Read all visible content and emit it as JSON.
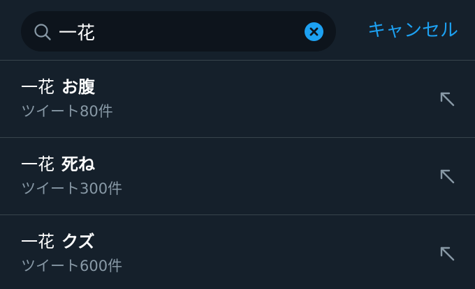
{
  "search": {
    "query": "一花",
    "placeholder": "",
    "clear_icon": "clear-circle-icon",
    "search_icon": "search-icon"
  },
  "header": {
    "cancel_label": "キャンセル"
  },
  "suggestions": [
    {
      "prefix": "一花",
      "suffix": "お腹",
      "count": "ツイート80件"
    },
    {
      "prefix": "一花",
      "suffix": "死ね",
      "count": "ツイート300件"
    },
    {
      "prefix": "一花",
      "suffix": "クズ",
      "count": "ツイート600件"
    }
  ],
  "colors": {
    "background": "#15202b",
    "search_field": "#0d141c",
    "accent": "#1da1f2",
    "secondary_text": "#8899a6",
    "divider": "#38444d"
  }
}
